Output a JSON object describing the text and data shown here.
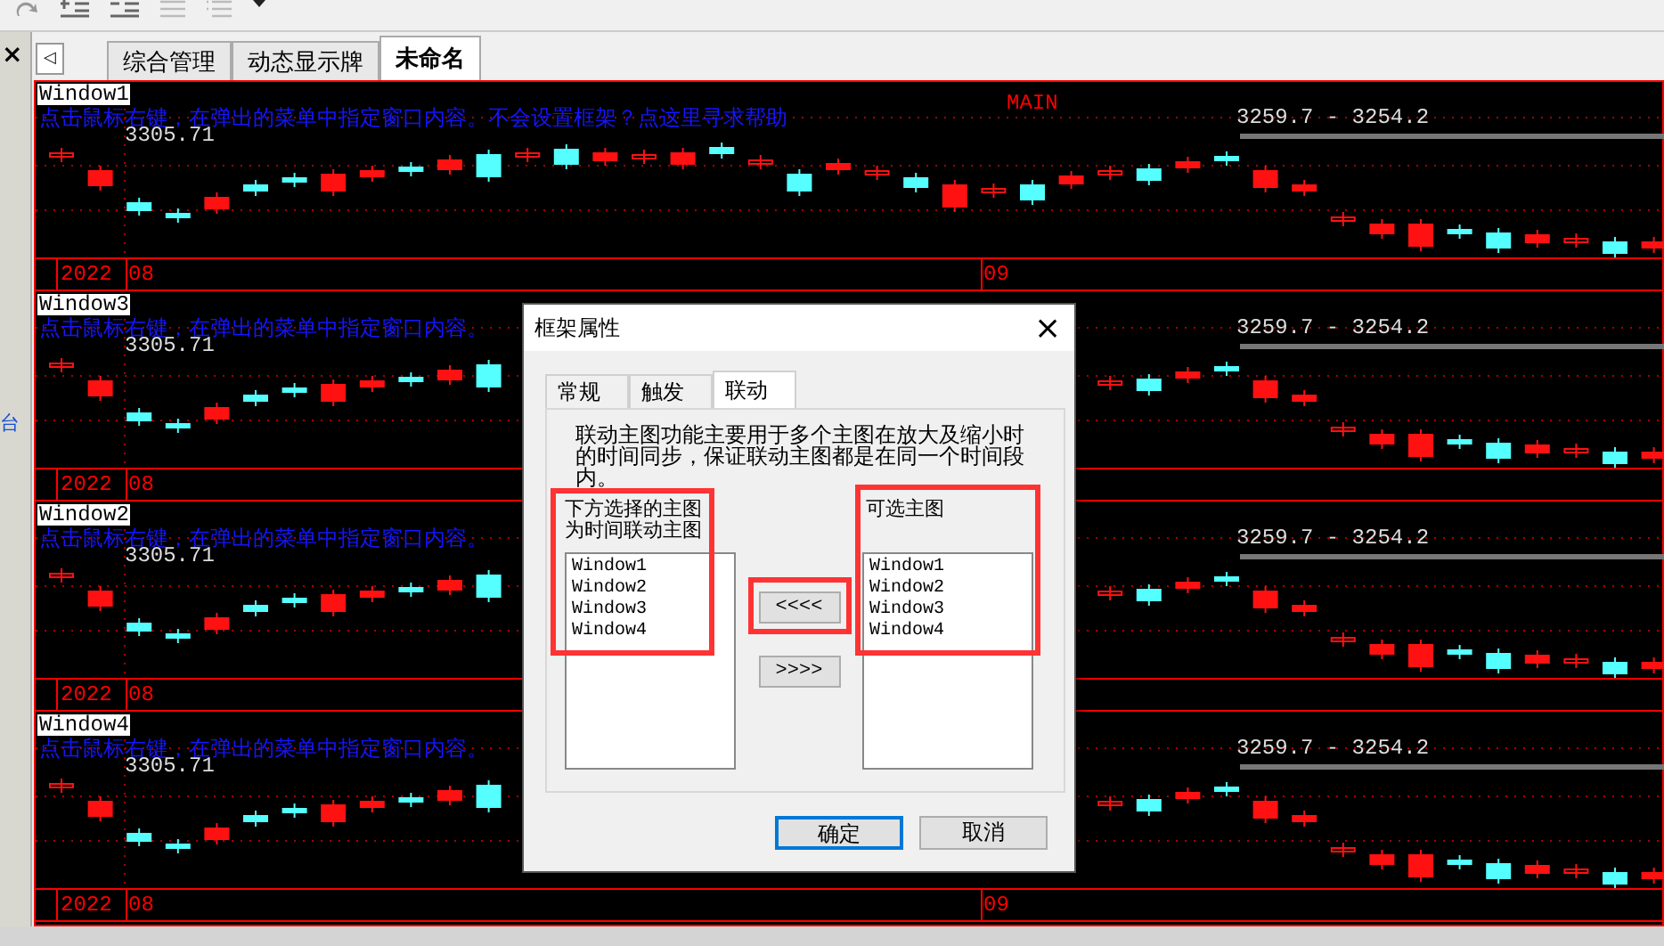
{
  "sidebar": {
    "close": "×",
    "label": "台"
  },
  "tab_scroll": "◁",
  "tabs": [
    {
      "label": "综合管理",
      "selected": false
    },
    {
      "label": "动态显示牌",
      "selected": false
    },
    {
      "label": "未命名",
      "selected": true
    }
  ],
  "panels": [
    {
      "window": "Window1",
      "hint": "点击鼠标右键，在弹出的菜单中指定窗口内容。不会设置框架？点这里寻求帮助",
      "main_label": "MAIN",
      "price": "3305.71",
      "range": "3259.7 - 3254.2",
      "axis": [
        "2022",
        "08",
        "09"
      ]
    },
    {
      "window": "Window3",
      "hint": "点击鼠标右键，在弹出的菜单中指定窗口内容。",
      "price": "3305.71",
      "range": "3259.7 - 3254.2",
      "axis": [
        "2022",
        "08"
      ]
    },
    {
      "window": "Window2",
      "hint": "点击鼠标右键，在弹出的菜单中指定窗口内容。",
      "price": "3305.71",
      "range": "3259.7 - 3254.2",
      "axis": [
        "2022",
        "08"
      ]
    },
    {
      "window": "Window4",
      "hint": "点击鼠标右键，在弹出的菜单中指定窗口内容。",
      "price": "3305.71",
      "range": "3259.7 - 3254.2",
      "axis": [
        "2022",
        "08",
        "09"
      ]
    }
  ],
  "dialog": {
    "title": "框架属性",
    "close": "×",
    "tabs": [
      {
        "label": "常规",
        "selected": false
      },
      {
        "label": "触发",
        "selected": false
      },
      {
        "label": "联动",
        "selected": true
      }
    ],
    "description": "联动主图功能主要用于多个主图在放大及缩小时的时间同步，保证联动主图都是在同一个时间段内。",
    "left_label": "下方选择的主图为时间联动主图",
    "left_list": [
      "Window1",
      "Window2",
      "Window3",
      "Window4"
    ],
    "right_label": "可选主图",
    "right_list": [
      "Window1",
      "Window2",
      "Window3",
      "Window4"
    ],
    "move_left": "<<<<",
    "move_right": ">>>>",
    "buttons": [
      {
        "label": "确定",
        "kind": "default"
      },
      {
        "label": "取消",
        "kind": "normal"
      }
    ]
  }
}
